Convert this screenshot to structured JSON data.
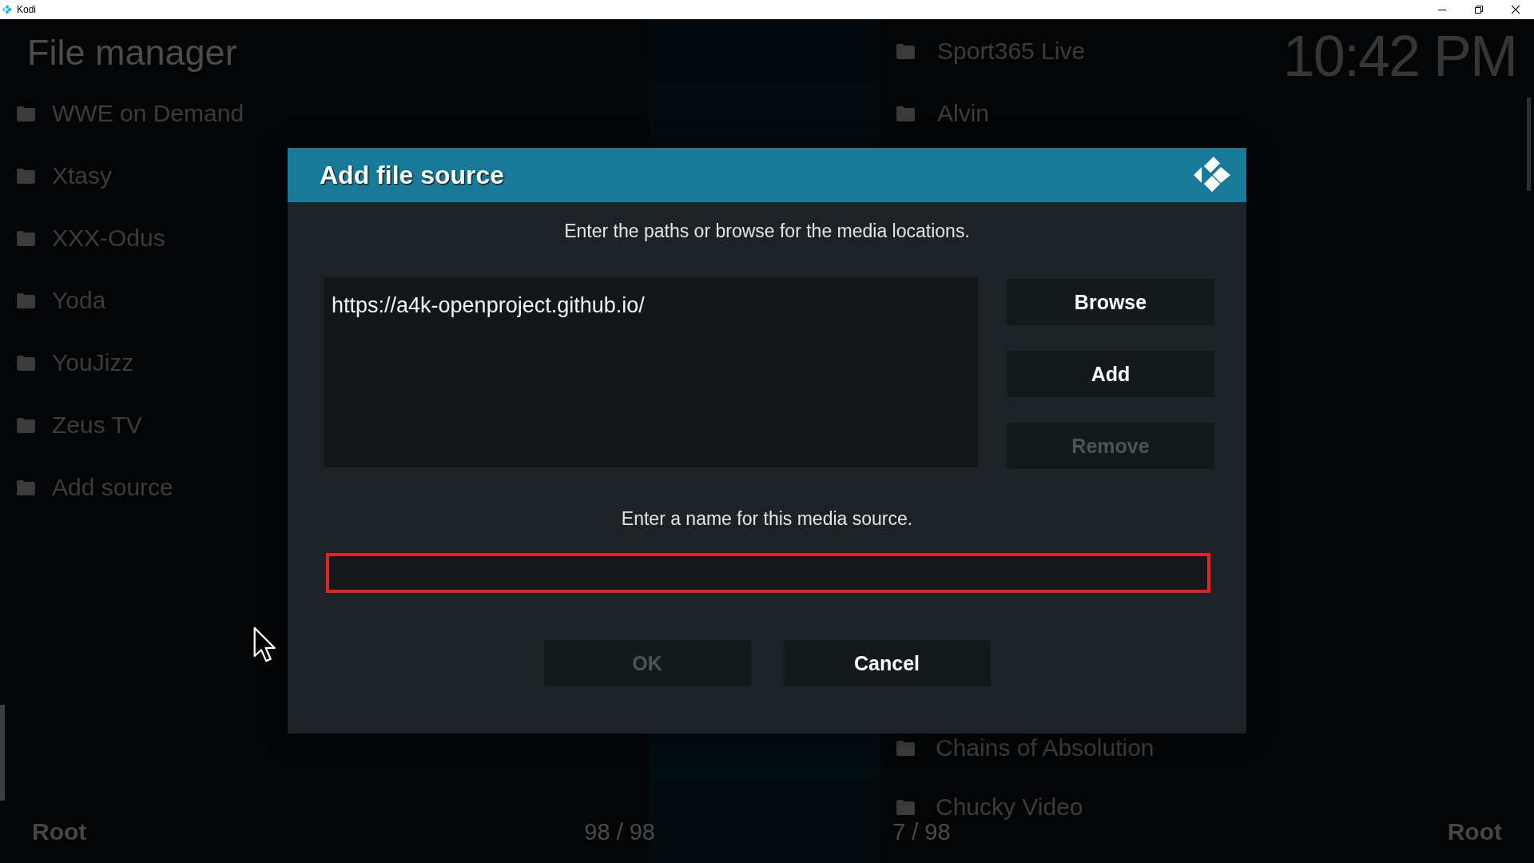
{
  "window": {
    "title": "Kodi"
  },
  "header": {
    "title": "File manager",
    "clock": "10:42 PM"
  },
  "left_pane": {
    "items": [
      "WWE on Demand",
      "Xtasy",
      "XXX-Odus",
      "Yoda",
      "YouJizz",
      "Zeus TV",
      "Add source"
    ],
    "footer_label": "Root",
    "count": "98 / 98"
  },
  "right_pane": {
    "items_top": [
      "Sport365 Live",
      "Alvin"
    ],
    "items_bottom": [
      "Chains of Absolution",
      "Chucky Video"
    ],
    "count": "7 / 98",
    "footer_label": "Root"
  },
  "dialog": {
    "title": "Add file source",
    "paths_prompt": "Enter the paths or browse for the media locations.",
    "paths": [
      "https://a4k-openproject.github.io/"
    ],
    "side_buttons": [
      {
        "label": "Browse",
        "disabled": false
      },
      {
        "label": "Add",
        "disabled": false
      },
      {
        "label": "Remove",
        "disabled": true
      }
    ],
    "name_prompt": "Enter a name for this media source.",
    "name_field": {
      "focused": true
    },
    "buttons": [
      {
        "label": "OK",
        "disabled": true
      },
      {
        "label": "Cancel",
        "disabled": false
      }
    ]
  }
}
